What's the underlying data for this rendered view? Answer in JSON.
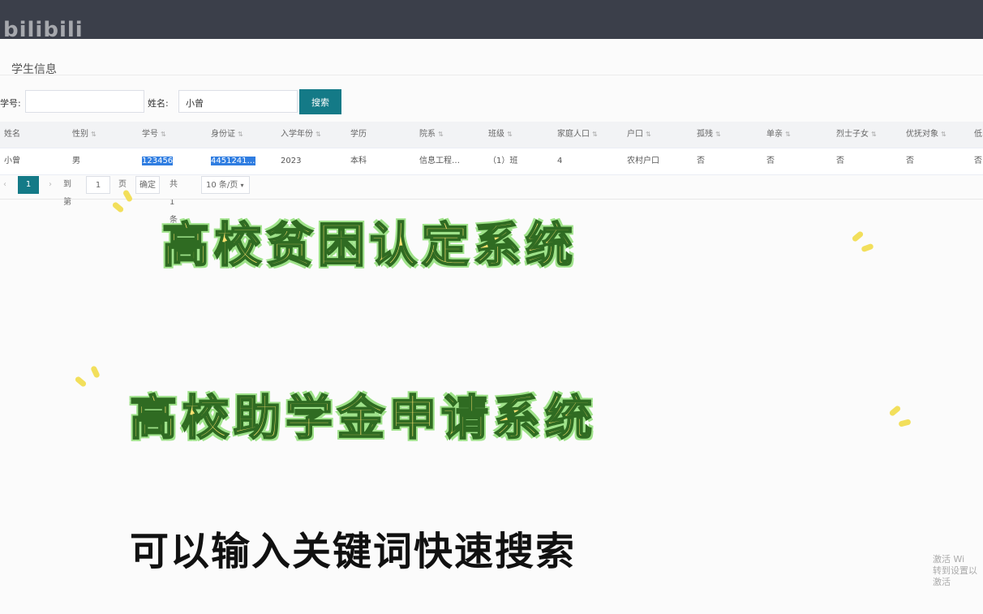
{
  "header": {
    "watermark": "bilibili"
  },
  "panel": {
    "title": "学生信息"
  },
  "search": {
    "student_id_label": "学号:",
    "student_id_value": "",
    "name_label": "姓名:",
    "name_value": "小曾",
    "search_button": "搜索"
  },
  "table": {
    "sort_glyph": "⇅",
    "columns": [
      "姓名",
      "性别",
      "学号",
      "身份证",
      "入学年份",
      "学历",
      "院系",
      "班级",
      "家庭人口",
      "户口",
      "孤残",
      "单亲",
      "烈士子女",
      "优抚对象",
      "低"
    ],
    "sortable": [
      false,
      true,
      true,
      true,
      true,
      false,
      true,
      true,
      true,
      true,
      true,
      true,
      true,
      true,
      false
    ],
    "rows": [
      [
        "小曾",
        "男",
        "123456",
        "4451241…",
        "2023",
        "本科",
        "信息工程…",
        "（1）班",
        "4",
        "农村户口",
        "否",
        "否",
        "否",
        "否",
        "否"
      ]
    ]
  },
  "pagination": {
    "prev": "‹",
    "current_page": "1",
    "next": "›",
    "goto_label": "到第",
    "goto_value": "1",
    "page_unit": "页",
    "confirm": "确定",
    "total": "共 1 条",
    "page_size": "10 条/页"
  },
  "overlay": {
    "title1": "高校贫困认定系统",
    "title2": "高校助学金申请系统",
    "caption": "可以输入关键词快速搜索",
    "corner_line1": "激活 Wi",
    "corner_line2": "转到设置以激活"
  },
  "colors": {
    "accent": "#147a87",
    "selection": "#2f7de1",
    "title_fill": "#ffe270",
    "title_glow": "#9fe28a"
  }
}
